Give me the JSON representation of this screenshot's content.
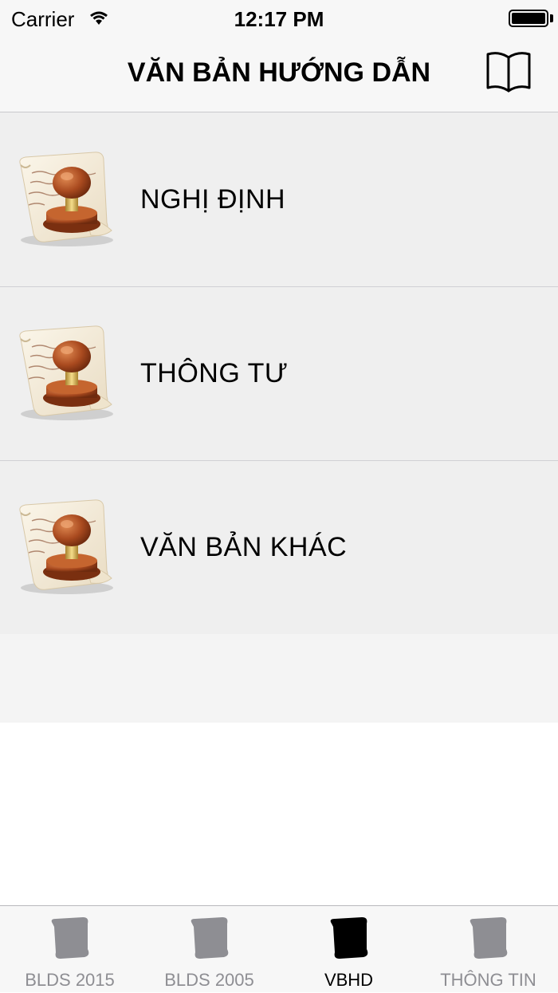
{
  "status_bar": {
    "carrier": "Carrier",
    "time": "12:17 PM"
  },
  "nav": {
    "title": "VĂN BẢN HƯỚNG DẪN",
    "right_icon": "book-icon"
  },
  "list": {
    "items": [
      {
        "label": "NGHỊ ĐỊNH",
        "icon": "stamp-document-icon"
      },
      {
        "label": "THÔNG TƯ",
        "icon": "stamp-document-icon"
      },
      {
        "label": "VĂN BẢN KHÁC",
        "icon": "stamp-document-icon"
      }
    ]
  },
  "tab_bar": {
    "tabs": [
      {
        "label": "BLDS 2015",
        "icon": "scroll-icon",
        "active": false
      },
      {
        "label": "BLDS 2005",
        "icon": "scroll-icon",
        "active": false
      },
      {
        "label": "VBHD",
        "icon": "scroll-icon",
        "active": true
      },
      {
        "label": "THÔNG TIN",
        "icon": "scroll-icon",
        "active": false
      }
    ]
  },
  "colors": {
    "bar_background": "#f7f7f7",
    "row_background": "#efefef",
    "tab_inactive": "#8e8e93",
    "tab_active": "#000000"
  }
}
